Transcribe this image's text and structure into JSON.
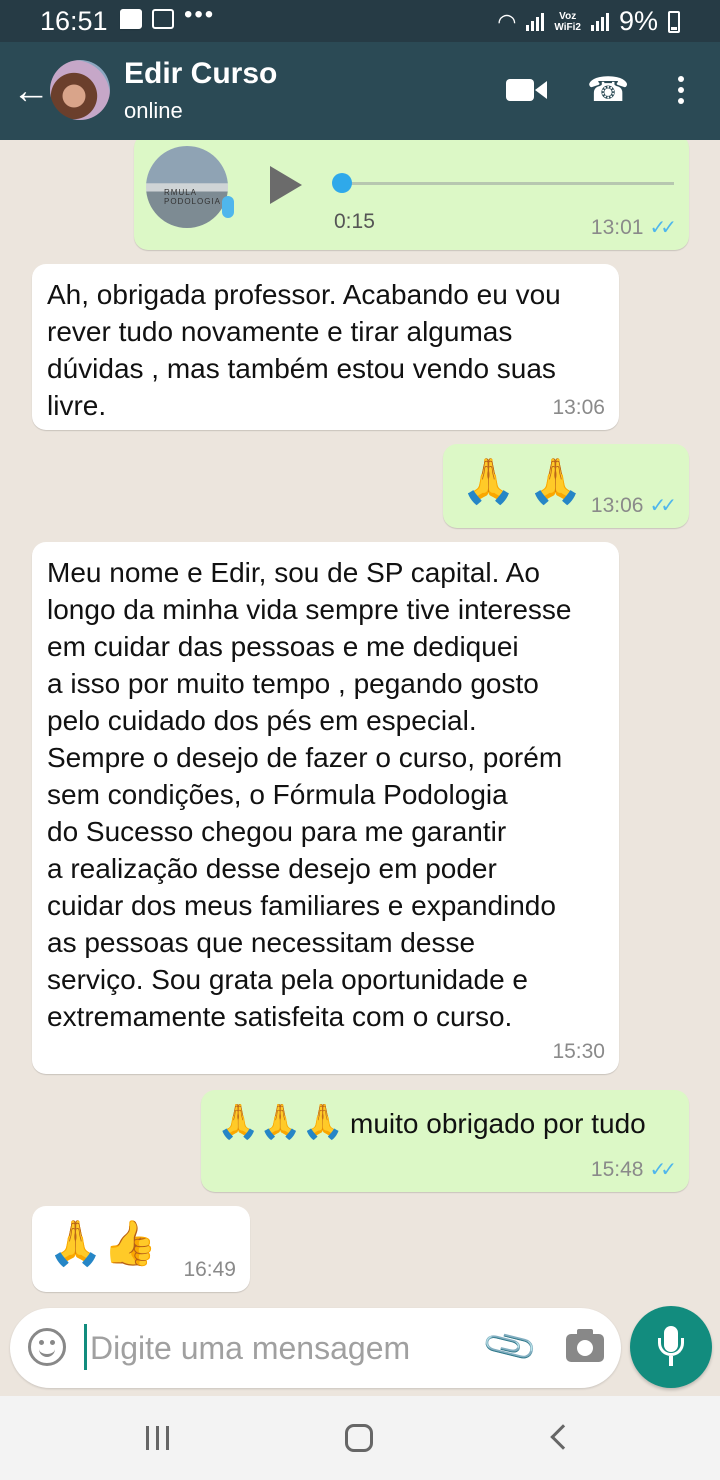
{
  "status_bar": {
    "time": "16:51",
    "dots": "•••",
    "network_label_top": "Voz",
    "network_label_bottom": "WiFi2",
    "battery": "9%",
    "icons": [
      "image-icon",
      "message-icon",
      "voicemail-icon",
      "wifi-icon",
      "signal-icon",
      "battery-icon"
    ]
  },
  "header": {
    "back_icon": "←",
    "contact_name": "Edir Curso",
    "status": "online",
    "call_icon": "☎"
  },
  "voice_message": {
    "duration": "0:15",
    "time": "13:01",
    "ticks": "✓✓",
    "thumbnail_text": "RMULA PODOLOGIA"
  },
  "messages": [
    {
      "direction": "incoming",
      "text": "Ah, obrigada professor. Acabando eu vou\nrever tudo novamente e tirar algumas\ndúvidas , mas também estou vendo suas\nlivre.",
      "time": "13:06"
    },
    {
      "direction": "outgoing",
      "emoji": "🙏 🙏",
      "time": "13:06",
      "ticks": "✓✓"
    },
    {
      "direction": "incoming",
      "text": "Meu nome e Edir, sou de SP capital. Ao\nlongo da minha vida sempre tive interesse\nem  cuidar das pessoas e me dediquei\na isso por muito tempo , pegando gosto\npelo cuidado dos pés em especial.\nSempre o desejo de fazer o curso, porém\nsem  condições, o Fórmula Podologia\ndo Sucesso chegou para me garantir\na realização desse desejo em poder\ncuidar dos meus familiares e expandindo\nas pessoas que necessitam desse\nserviço.  Sou grata pela oportunidade e\nextremamente satisfeita com o curso.",
      "time": "15:30"
    },
    {
      "direction": "outgoing",
      "emoji": "🙏🙏🙏",
      "text": "muito obrigado por tudo",
      "time": "15:48",
      "ticks": "✓✓"
    },
    {
      "direction": "incoming",
      "emoji": "🙏👍",
      "time": "16:49"
    }
  ],
  "composer": {
    "placeholder": "Digite uma mensagem",
    "clip_icon": "📎"
  },
  "colors": {
    "header": "#2b4a55",
    "status_bar": "#263b45",
    "outgoing_bubble": "#dcf8c6",
    "incoming_bubble": "#ffffff",
    "read_ticks": "#4fb6ec",
    "mic_button": "#128c7e"
  }
}
